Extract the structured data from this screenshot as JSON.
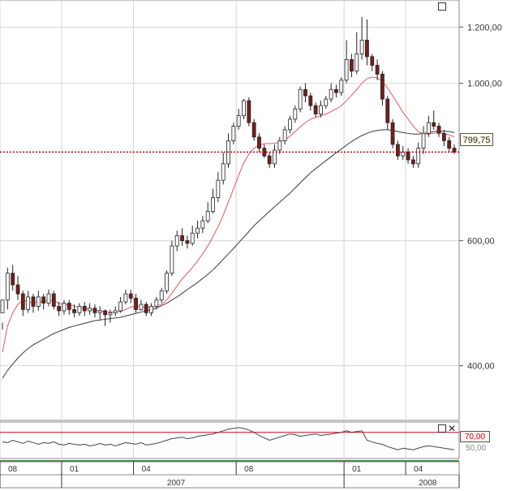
{
  "chart_data": {
    "type": "candlestick",
    "price_axis": {
      "scale": "log",
      "range": [
        335,
        1310
      ],
      "ticks": [
        {
          "value": 400,
          "label": "400,00"
        },
        {
          "value": 600,
          "label": "600,00"
        },
        {
          "value": 1000,
          "label": "1.000,00"
        },
        {
          "value": 1200,
          "label": "1.200,00"
        }
      ]
    },
    "x_axis": {
      "months": [
        {
          "label": "08",
          "x": 0
        },
        {
          "label": "01",
          "x": 12
        },
        {
          "label": "04",
          "x": 26
        },
        {
          "label": "08",
          "x": 46
        },
        {
          "label": "01",
          "x": 67
        },
        {
          "label": "04",
          "x": 79
        }
      ],
      "years": [
        {
          "label": "2007",
          "x": 21
        },
        {
          "label": "2008",
          "x": 70
        }
      ]
    },
    "current_price": {
      "value": 800,
      "label": "799,75",
      "color": "#cc0000"
    },
    "candles": [
      [
        475,
        495,
        460,
        450
      ],
      [
        495,
        540,
        550,
        480
      ],
      [
        540,
        520,
        555,
        510
      ],
      [
        520,
        505,
        535,
        495
      ],
      [
        505,
        480,
        510,
        470
      ],
      [
        480,
        500,
        510,
        475
      ],
      [
        500,
        485,
        505,
        475
      ],
      [
        485,
        500,
        510,
        478
      ],
      [
        500,
        490,
        505,
        480
      ],
      [
        490,
        505,
        512,
        485
      ],
      [
        505,
        485,
        510,
        480
      ],
      [
        485,
        478,
        492,
        470
      ],
      [
        478,
        490,
        495,
        472
      ],
      [
        490,
        480,
        495,
        472
      ],
      [
        480,
        475,
        488,
        468
      ],
      [
        475,
        485,
        490,
        470
      ],
      [
        485,
        478,
        492,
        470
      ],
      [
        478,
        482,
        490,
        472
      ],
      [
        482,
        475,
        488,
        468
      ],
      [
        475,
        478,
        485,
        465
      ],
      [
        478,
        472,
        480,
        455
      ],
      [
        472,
        475,
        480,
        460
      ],
      [
        475,
        478,
        485,
        470
      ],
      [
        478,
        492,
        500,
        475
      ],
      [
        492,
        505,
        512,
        488
      ],
      [
        505,
        498,
        512,
        490
      ],
      [
        498,
        480,
        505,
        475
      ],
      [
        480,
        488,
        495,
        478
      ],
      [
        488,
        475,
        492,
        470
      ],
      [
        475,
        485,
        490,
        470
      ],
      [
        485,
        495,
        500,
        480
      ],
      [
        495,
        510,
        515,
        490
      ],
      [
        510,
        540,
        545,
        505
      ],
      [
        540,
        590,
        600,
        535
      ],
      [
        590,
        610,
        620,
        580
      ],
      [
        610,
        600,
        625,
        590
      ],
      [
        600,
        595,
        610,
        585
      ],
      [
        595,
        615,
        630,
        590
      ],
      [
        615,
        625,
        640,
        605
      ],
      [
        625,
        640,
        650,
        615
      ],
      [
        640,
        660,
        680,
        635
      ],
      [
        660,
        690,
        710,
        655
      ],
      [
        690,
        730,
        750,
        680
      ],
      [
        730,
        770,
        800,
        720
      ],
      [
        770,
        830,
        850,
        760
      ],
      [
        830,
        870,
        880,
        820
      ],
      [
        870,
        900,
        920,
        860
      ],
      [
        900,
        945,
        950,
        890
      ],
      [
        945,
        880,
        955,
        870
      ],
      [
        880,
        840,
        890,
        830
      ],
      [
        840,
        810,
        850,
        800
      ],
      [
        810,
        790,
        820,
        785
      ],
      [
        790,
        770,
        800,
        760
      ],
      [
        770,
        805,
        820,
        760
      ],
      [
        805,
        830,
        840,
        795
      ],
      [
        830,
        860,
        870,
        820
      ],
      [
        860,
        890,
        900,
        850
      ],
      [
        890,
        920,
        930,
        880
      ],
      [
        920,
        980,
        990,
        910
      ],
      [
        980,
        960,
        1000,
        940
      ],
      [
        960,
        930,
        970,
        915
      ],
      [
        930,
        905,
        940,
        895
      ],
      [
        905,
        930,
        945,
        895
      ],
      [
        930,
        950,
        960,
        920
      ],
      [
        950,
        980,
        1000,
        940
      ],
      [
        980,
        970,
        995,
        955
      ],
      [
        970,
        1010,
        1020,
        960
      ],
      [
        1010,
        1080,
        1150,
        1000
      ],
      [
        1080,
        1040,
        1100,
        1020
      ],
      [
        1040,
        1100,
        1180,
        1030
      ],
      [
        1100,
        1150,
        1240,
        1080
      ],
      [
        1150,
        1090,
        1230,
        1060
      ],
      [
        1090,
        1060,
        1100,
        1040
      ],
      [
        1060,
        1030,
        1080,
        1010
      ],
      [
        1030,
        950,
        1040,
        930
      ],
      [
        950,
        880,
        960,
        860
      ],
      [
        880,
        820,
        890,
        810
      ],
      [
        820,
        790,
        830,
        780
      ],
      [
        790,
        800,
        815,
        780
      ],
      [
        800,
        780,
        810,
        770
      ],
      [
        780,
        770,
        790,
        760
      ],
      [
        770,
        810,
        825,
        760
      ],
      [
        810,
        850,
        870,
        795
      ],
      [
        850,
        880,
        900,
        840
      ],
      [
        880,
        870,
        915,
        860
      ],
      [
        870,
        850,
        880,
        840
      ],
      [
        850,
        830,
        860,
        815
      ],
      [
        830,
        810,
        840,
        800
      ],
      [
        810,
        800,
        820,
        795
      ]
    ],
    "sma_fast": [
      418,
      455,
      475,
      488,
      495,
      492,
      490,
      493,
      492,
      495,
      494,
      490,
      487,
      488,
      485,
      483,
      482,
      481,
      479,
      478,
      477,
      476,
      476,
      477,
      480,
      484,
      485,
      484,
      483,
      483,
      485,
      488,
      495,
      506,
      518,
      530,
      540,
      550,
      562,
      575,
      590,
      608,
      628,
      652,
      680,
      710,
      742,
      772,
      795,
      810,
      818,
      822,
      822,
      823,
      826,
      832,
      842,
      855,
      868,
      880,
      890,
      895,
      900,
      905,
      912,
      920,
      930,
      945,
      962,
      980,
      1000,
      1015,
      1020,
      1018,
      1005,
      985,
      960,
      935,
      910,
      890,
      870,
      855,
      848,
      848,
      850,
      852,
      850,
      846,
      840
    ],
    "sma_slow": [
      384,
      394,
      402,
      410,
      417,
      423,
      428,
      432,
      436,
      440,
      444,
      447,
      450,
      453,
      455,
      457,
      459,
      461,
      463,
      464,
      465,
      466,
      467,
      468,
      470,
      472,
      474,
      476,
      478,
      480,
      482,
      486,
      490,
      495,
      500,
      506,
      512,
      518,
      524,
      531,
      538,
      546,
      555,
      565,
      575,
      585,
      596,
      607,
      618,
      630,
      640,
      650,
      660,
      670,
      680,
      690,
      700,
      712,
      724,
      736,
      748,
      758,
      768,
      778,
      788,
      798,
      808,
      818,
      828,
      836,
      844,
      850,
      855,
      858,
      860,
      860,
      858,
      855,
      852,
      850,
      848,
      848,
      850,
      852,
      855,
      856,
      856,
      855,
      852
    ],
    "rsi": {
      "upper_level": {
        "value": 70,
        "label": "70,00"
      },
      "lower_label": "50,00",
      "values": [
        58,
        57,
        60,
        58,
        56,
        59,
        57,
        55,
        57,
        56,
        58,
        55,
        54,
        56,
        55,
        54,
        55,
        53,
        54,
        56,
        54,
        55,
        53,
        55,
        57,
        56,
        55,
        57,
        54,
        55,
        56,
        58,
        60,
        62,
        63,
        64,
        62,
        63,
        65,
        66,
        67,
        68,
        70,
        72,
        74,
        75,
        76,
        75,
        73,
        70,
        66,
        63,
        60,
        62,
        64,
        66,
        68,
        67,
        65,
        66,
        67,
        68,
        66,
        67,
        68,
        69,
        70,
        72,
        70,
        71,
        72,
        60,
        58,
        56,
        55,
        52,
        50,
        48,
        50,
        49,
        48,
        50,
        52,
        53,
        52,
        51,
        50,
        49,
        48
      ]
    }
  },
  "labels": {
    "price_tag": "799,75",
    "rsi_tag": "70,00",
    "rsi_lower": "50,00"
  },
  "icons": {
    "main_maximize": "maximize-icon",
    "rsi_maximize": "maximize-icon",
    "rsi_close": "close-icon"
  },
  "colors": {
    "up_body": "#ffffff",
    "down_body": "#7a1c1c",
    "fast_ma": "#e15a5a",
    "slow_ma": "#3a3a3a",
    "rsi_line": "#444444",
    "rsi_level": "#d0021b",
    "separator": "#3a7a3a"
  }
}
